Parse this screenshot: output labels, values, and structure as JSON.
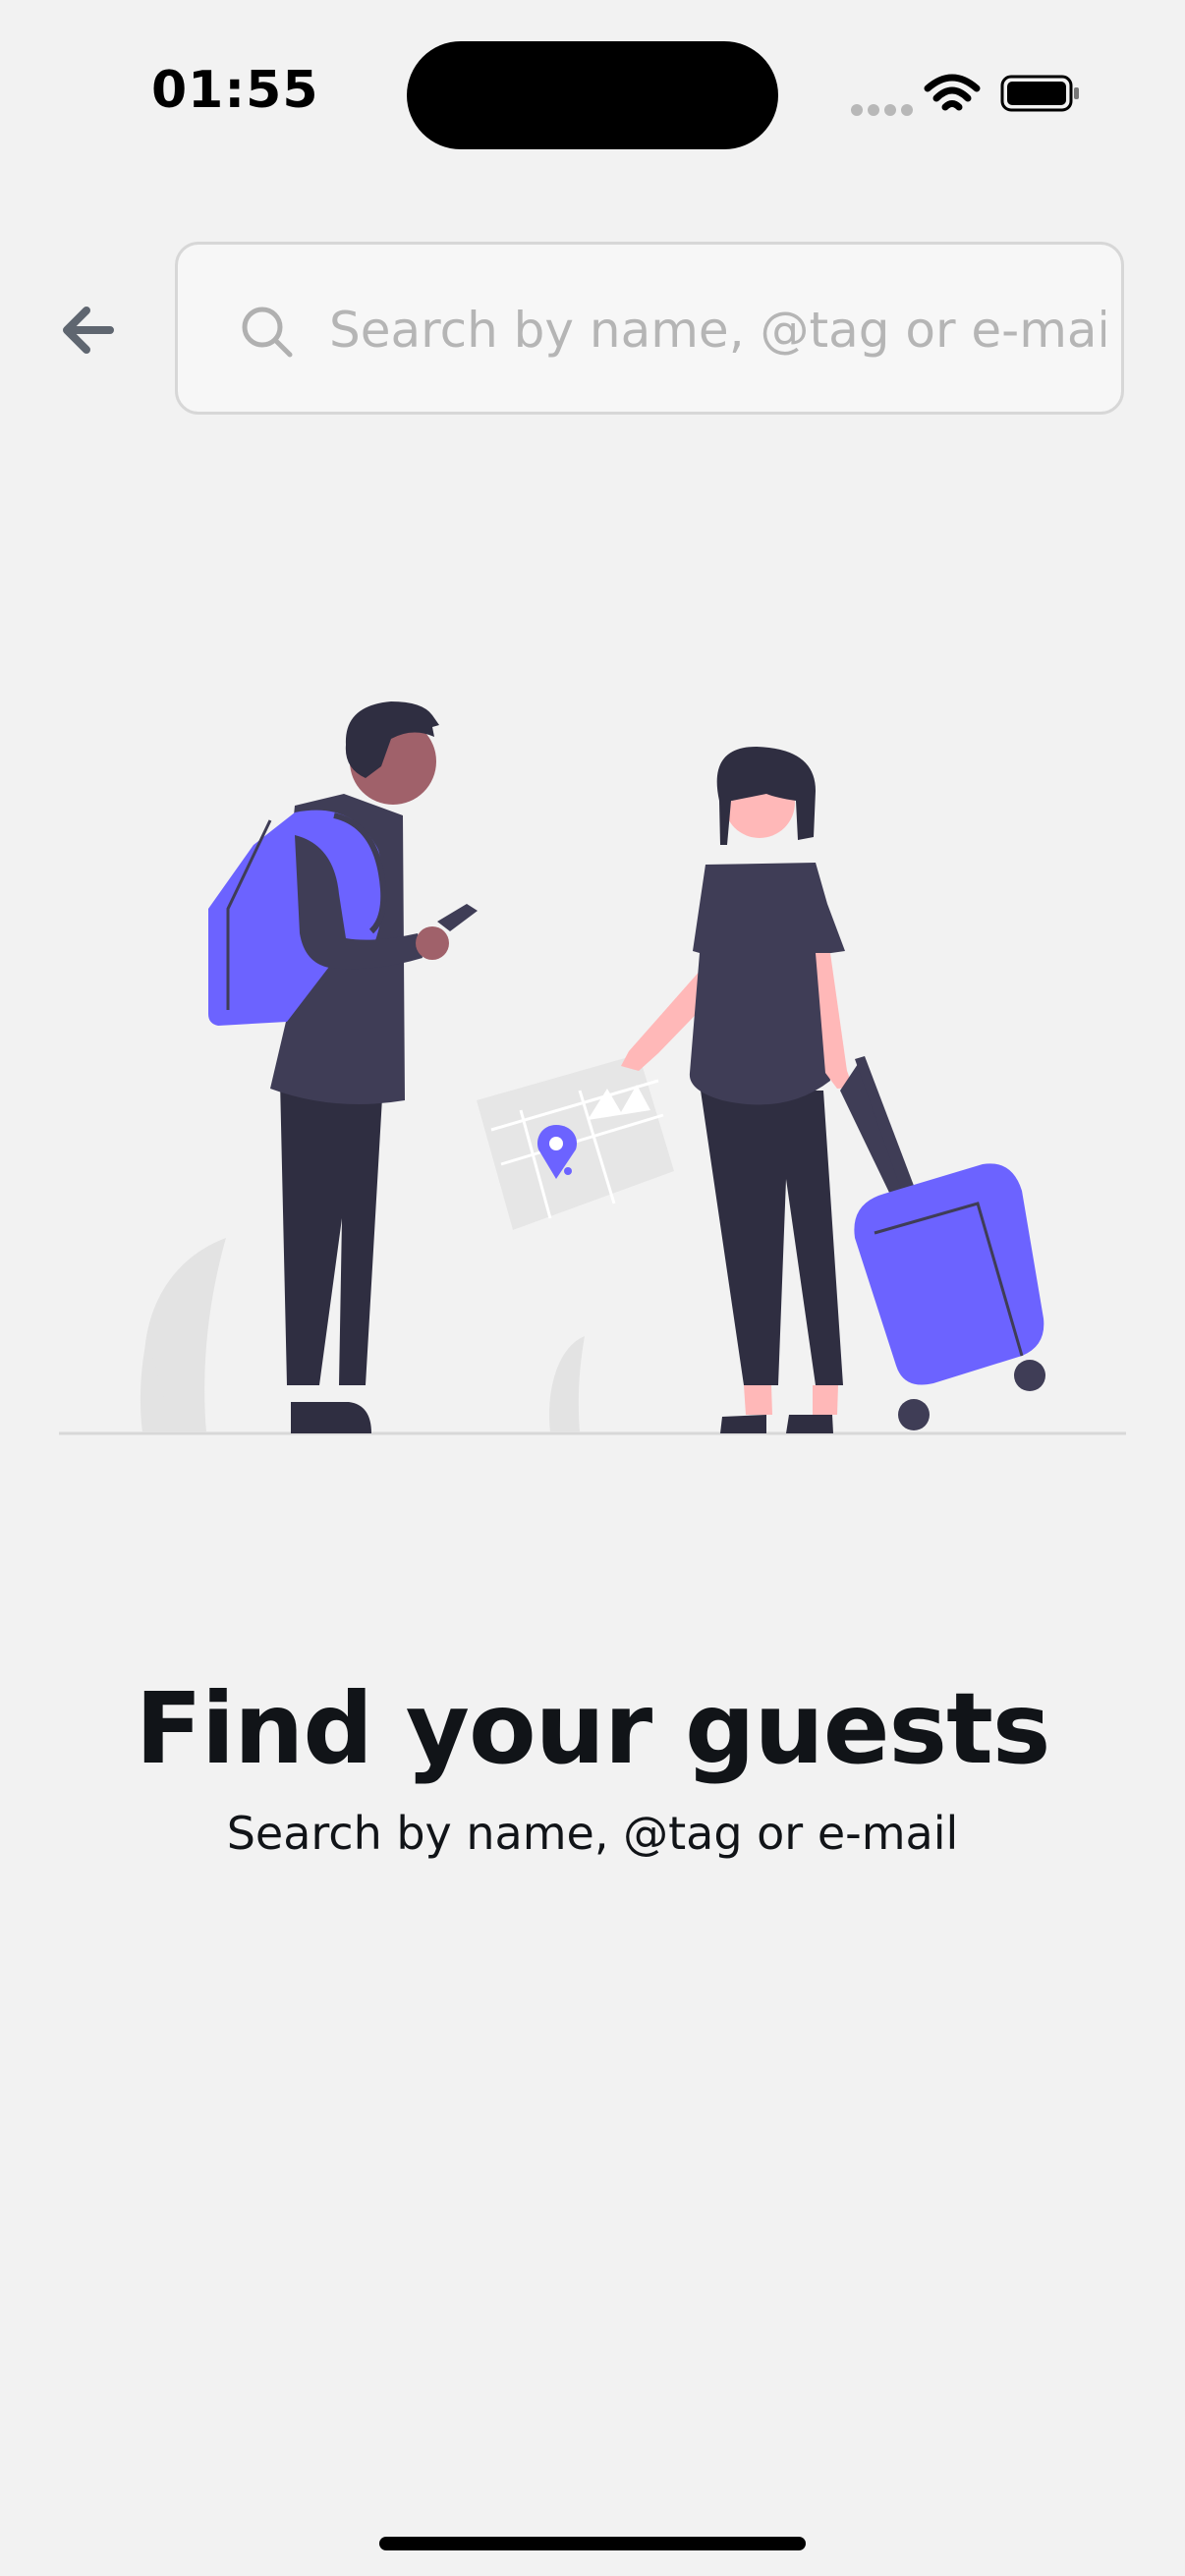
{
  "status_bar": {
    "time": "01:55",
    "icons": [
      "cellular-signal-icon",
      "wifi-icon",
      "battery-icon"
    ]
  },
  "header": {
    "back_icon": "arrow-left-icon",
    "search": {
      "placeholder": "Search by name, @tag or e-mail",
      "value": "",
      "icon": "search-icon"
    }
  },
  "empty_state": {
    "illustration": "two-travelers-with-map-and-suitcase-illustration",
    "title": "Find your guests",
    "subtitle": "Search by name, @tag or e-mail"
  },
  "colors": {
    "background": "#f2f2f2",
    "accent": "#6c63ff",
    "text_primary": "#111418",
    "placeholder": "#b5b5b5",
    "figure_dark": "#3f3d56"
  }
}
